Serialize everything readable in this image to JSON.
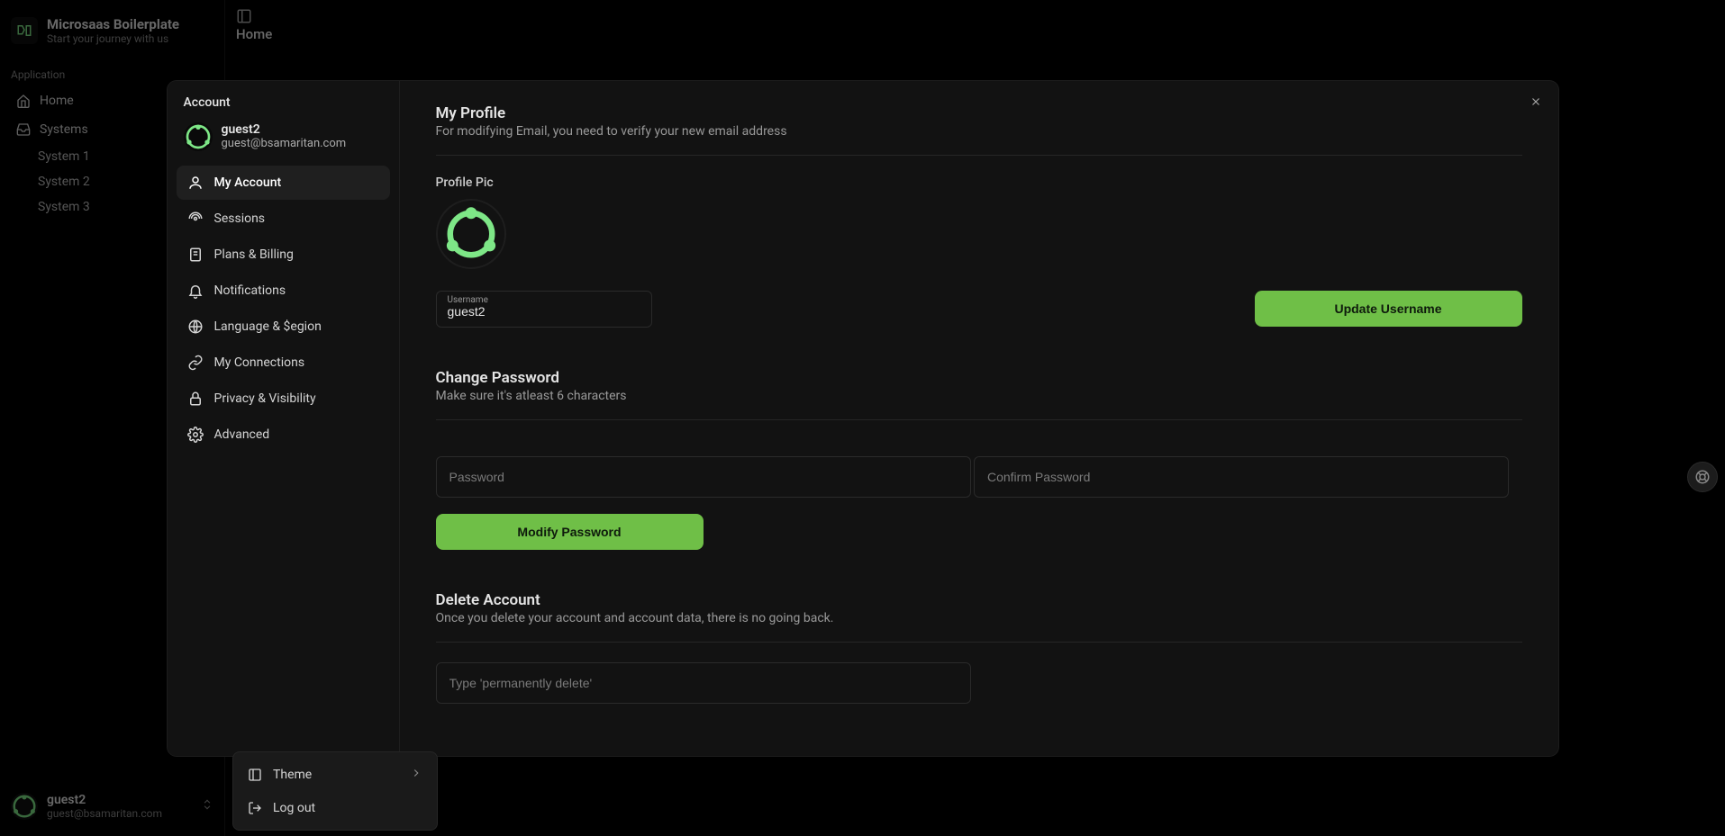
{
  "brand": {
    "name": "Microsaas Boilerplate",
    "tagline": "Start your journey with us"
  },
  "sidebar": {
    "section_label": "Application",
    "items": [
      {
        "label": "Home",
        "icon": "home-icon"
      },
      {
        "label": "Systems",
        "icon": "inbox-icon"
      }
    ],
    "subitems": [
      {
        "label": "System 1"
      },
      {
        "label": "System 2"
      },
      {
        "label": "System 3"
      }
    ],
    "footer": {
      "name": "guest2",
      "email": "guest@bsamaritan.com"
    }
  },
  "header": {
    "title": "Home"
  },
  "modal": {
    "title": "Account",
    "user": {
      "name": "guest2",
      "email": "guest@bsamaritan.com"
    },
    "nav": [
      {
        "label": "My Account",
        "icon": "user-icon",
        "active": true
      },
      {
        "label": "Sessions",
        "icon": "broadcast-icon",
        "active": false
      },
      {
        "label": "Plans & Billing",
        "icon": "receipt-icon",
        "active": false
      },
      {
        "label": "Notifications",
        "icon": "bell-icon",
        "active": false
      },
      {
        "label": "Language & $egion",
        "icon": "globe-icon",
        "active": false
      },
      {
        "label": "My Connections",
        "icon": "link-icon",
        "active": false
      },
      {
        "label": "Privacy & Visibility",
        "icon": "lock-icon",
        "active": false
      },
      {
        "label": "Advanced",
        "icon": "gear-icon",
        "active": false
      }
    ]
  },
  "profile": {
    "heading": "My Profile",
    "desc": "For modifying Email, you need to verify your new email address",
    "pic_label": "Profile Pic",
    "username_label": "Username",
    "username_value": "guest2",
    "update_btn": "Update Username"
  },
  "password": {
    "heading": "Change Password",
    "desc": "Make sure it's atleast 6 characters",
    "ph_password": "Password",
    "ph_confirm": "Confirm Password",
    "modify_btn": "Modify Password"
  },
  "delete": {
    "heading": "Delete Account",
    "desc": "Once you delete your account and account data, there is no going back.",
    "ph_confirm": "Type 'permanently delete'"
  },
  "popover": {
    "theme": "Theme",
    "logout": "Log out"
  }
}
